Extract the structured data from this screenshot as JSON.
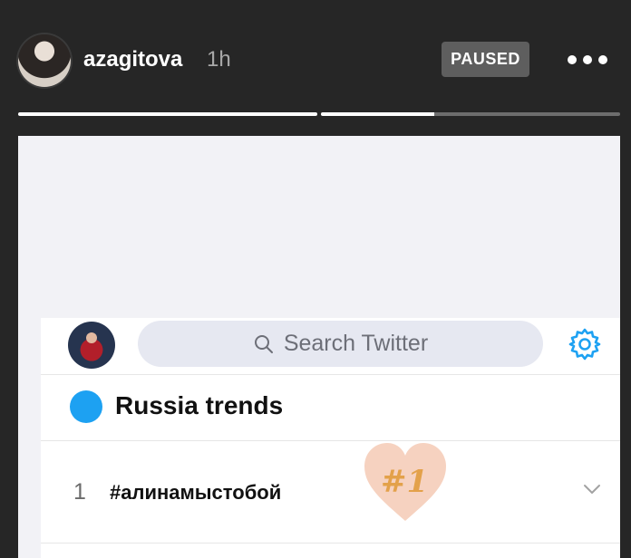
{
  "story": {
    "username": "azagitova",
    "timestamp": "1h",
    "paused_label": "PAUSED",
    "progress": [
      1.0,
      0.38
    ]
  },
  "twitter": {
    "search_placeholder": "Search Twitter",
    "trends_heading": "Russia trends",
    "trend": {
      "rank": "1",
      "hashtag": "#алинамыстобой",
      "sticker_text": "#1"
    }
  },
  "icons": [
    "more-icon",
    "search-icon",
    "settings-icon",
    "chevron-down-icon",
    "heart-sticker"
  ],
  "colors": {
    "background": "#262626",
    "twitter_blue": "#1da1f2",
    "sticker_heart": "#f6d2c0",
    "sticker_text": "#e3a14a"
  }
}
